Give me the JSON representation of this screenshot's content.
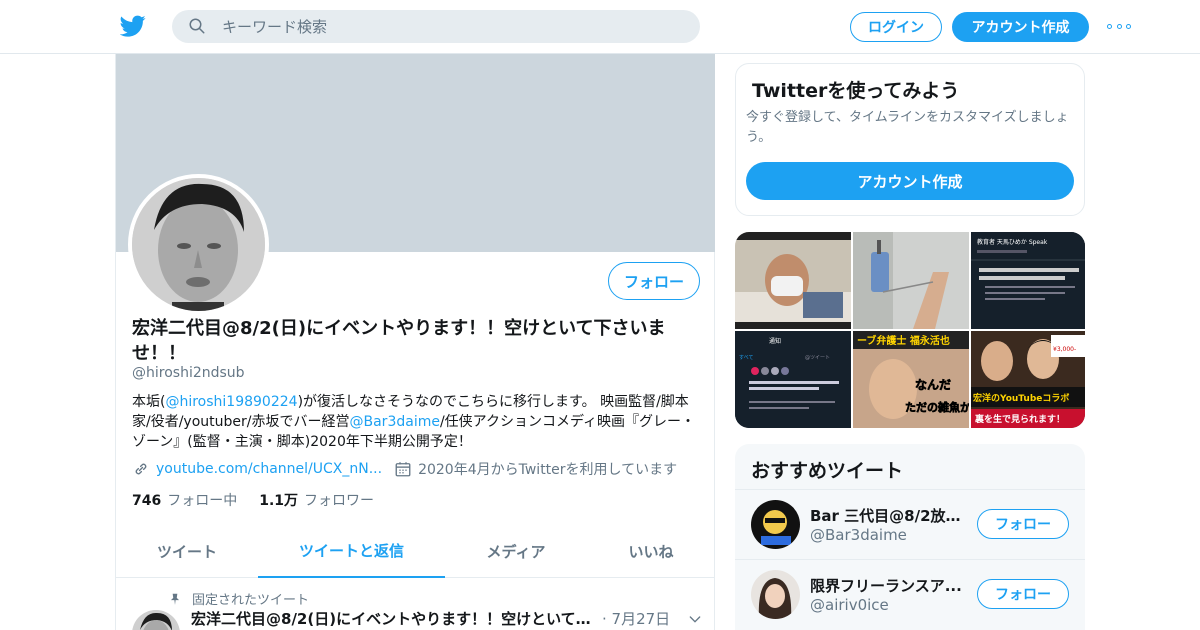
{
  "header": {
    "search_placeholder": "キーワード検索",
    "login_label": "ログイン",
    "signup_label": "アカウント作成"
  },
  "profile": {
    "follow_label": "フォロー",
    "display_name": "宏洋二代目@8/2(日)にイベントやります！！空けといて下さいませ！！",
    "handle": "@hiroshi2ndsub",
    "bio": {
      "part1": "本垢(",
      "mention1": "@hiroshi19890224",
      "part2": ")が復活しなさそうなのでこちらに移行します。 映画監督/脚本家/役者/youtuber/赤坂でバー経営",
      "mention2": "@Bar3daime",
      "part3": "/任侠アクションコメディ映画『グレー・ゾーン』(監督・主演・脚本)2020年下半期公開予定！"
    },
    "website": "youtube.com/channel/UCX_nN...",
    "joined": "2020年4月からTwitterを利用しています",
    "following_count": "746",
    "following_label": "フォロー中",
    "followers_count": "1.1万",
    "followers_label": "フォロワー",
    "tabs": [
      "ツイート",
      "ツイートと返信",
      "メディア",
      "いいね"
    ],
    "active_tab": 1,
    "pinned_label": "固定されたツイート",
    "pinned_tweet": {
      "name": "宏洋二代目@8/2(日)にイベントやります！！空けといて下さいませ！！",
      "date": "· 7月27日"
    }
  },
  "sidebar": {
    "signup_card": {
      "title": "Twitterを使ってみよう",
      "description": "今すぐ登録して、タイムラインをカスタマイズしましょう。",
      "cta": "アカウント作成"
    },
    "media_thumbs": [
      {
        "kind": "hospital-selfie",
        "text": ""
      },
      {
        "kind": "iv-drip",
        "text": ""
      },
      {
        "kind": "blocked-screen",
        "text": "@amaseshimika147さんはあなたをブロックしました"
      },
      {
        "kind": "app-screen",
        "text": "通知"
      },
      {
        "kind": "thumbnail-lawyer",
        "text": "ーブ弁護士 福永活也"
      },
      {
        "kind": "thumbnail-collab",
        "text": "宏洋のYouTubeコラボ"
      }
    ],
    "thumb_overlay_text": {
      "blocked_title": "教育者 天馬ひめか Speak",
      "price": "¥3,000-",
      "nanda": "なんだ",
      "tada": "ただの雑魚か",
      "collab_sub": "裏を生で見られます！",
      "tab_all": "すべて",
      "tab_mention": "@ツイート"
    },
    "recommended": {
      "title": "おすすめツイート",
      "users": [
        {
          "name": "Bar 三代目@8/2放送...",
          "handle": "@Bar3daime",
          "follow": "フォロー"
        },
        {
          "name": "限界フリーランスア...",
          "handle": "@airiv0ice",
          "follow": "フォロー"
        }
      ]
    }
  },
  "colors": {
    "accent": "#1da1f2",
    "banner": "#ccd6dd",
    "muted_text": "#657786"
  }
}
